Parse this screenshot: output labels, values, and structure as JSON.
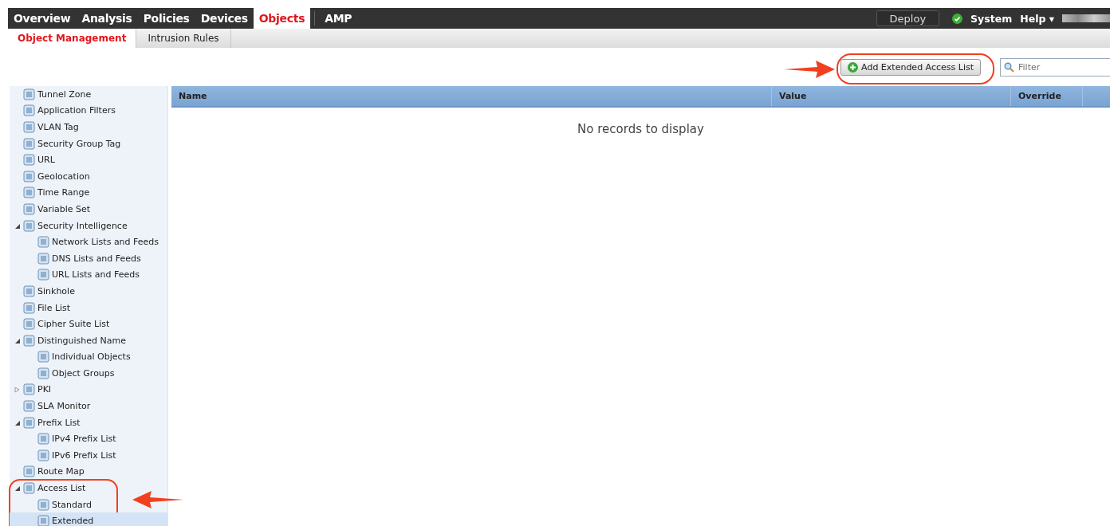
{
  "main_nav": [
    {
      "label": "Overview",
      "selected": false
    },
    {
      "label": "Analysis",
      "selected": false
    },
    {
      "label": "Policies",
      "selected": false
    },
    {
      "label": "Devices",
      "selected": false
    },
    {
      "label": "Objects",
      "selected": true
    },
    {
      "label": "AMP",
      "selected": false
    }
  ],
  "top_right": {
    "deploy": "Deploy",
    "system": "System",
    "help": "Help ▾"
  },
  "sub_tabs": [
    {
      "label": "Object Management",
      "selected": true
    },
    {
      "label": "Intrusion Rules",
      "selected": false
    }
  ],
  "toolbar": {
    "add_button": "Add Extended Access List",
    "filter": {
      "placeholder": "Filter"
    }
  },
  "tree": [
    {
      "label": "Tunnel Zone",
      "selected": false
    },
    {
      "label": "Application Filters",
      "selected": false
    },
    {
      "label": "VLAN Tag",
      "selected": false
    },
    {
      "label": "Security Group Tag",
      "selected": false
    },
    {
      "label": "URL",
      "selected": false
    },
    {
      "label": "Geolocation",
      "selected": false
    },
    {
      "label": "Time Range",
      "selected": false
    },
    {
      "label": "Variable Set",
      "selected": false
    },
    {
      "label": "Security Intelligence",
      "selected": false,
      "expanded": true,
      "children": [
        {
          "label": "Network Lists and Feeds",
          "selected": false
        },
        {
          "label": "DNS Lists and Feeds",
          "selected": false
        },
        {
          "label": "URL Lists and Feeds",
          "selected": false
        }
      ]
    },
    {
      "label": "Sinkhole",
      "selected": false
    },
    {
      "label": "File List",
      "selected": false
    },
    {
      "label": "Cipher Suite List",
      "selected": false
    },
    {
      "label": "Distinguished Name",
      "selected": false,
      "expanded": true,
      "children": [
        {
          "label": "Individual Objects",
          "selected": false
        },
        {
          "label": "Object Groups",
          "selected": false
        }
      ]
    },
    {
      "label": "PKI",
      "selected": false,
      "expanded": false
    },
    {
      "label": "SLA Monitor",
      "selected": false
    },
    {
      "label": "Prefix List",
      "selected": false,
      "expanded": true,
      "children": [
        {
          "label": "IPv4 Prefix List",
          "selected": false
        },
        {
          "label": "IPv6 Prefix List",
          "selected": false
        }
      ]
    },
    {
      "label": "Route Map",
      "selected": false
    },
    {
      "label": "Access List",
      "selected": false,
      "expanded": true,
      "children": [
        {
          "label": "Standard",
          "selected": false
        },
        {
          "label": "Extended",
          "selected": true
        }
      ]
    }
  ],
  "table": {
    "columns": [
      "Name",
      "Value",
      "Override"
    ],
    "empty_message": "No records to display"
  }
}
